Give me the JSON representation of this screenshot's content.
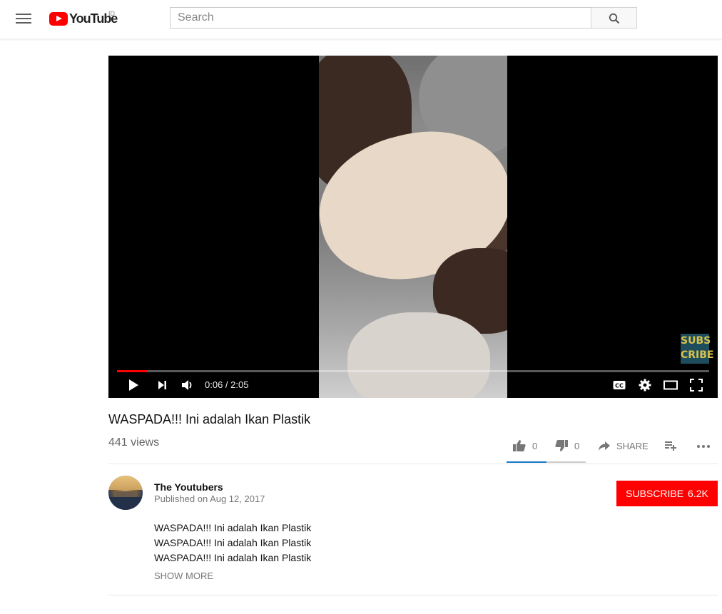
{
  "header": {
    "logo_text": "YouTube",
    "country_code": "ID",
    "search_placeholder": "Search",
    "icons": [
      "menu-icon",
      "youtube-logo",
      "search-icon"
    ]
  },
  "player": {
    "time_current": "0:06",
    "time_separator": " / ",
    "time_total": "2:05",
    "progress_fraction": 0.05,
    "watermark": {
      "line1": "SUBS",
      "line2": "CRIBE"
    },
    "icons": [
      "play-icon",
      "next-icon",
      "volume-icon",
      "captions-icon",
      "settings-icon",
      "theater-mode-icon",
      "fullscreen-icon"
    ],
    "colors": {
      "progress": "#ff0000",
      "background": "#000000"
    }
  },
  "video": {
    "title": "WASPADA!!! Ini adalah Ikan Plastik",
    "views": "441 views"
  },
  "actions": {
    "likes": "0",
    "dislikes": "0",
    "share_label": "SHARE",
    "like_fraction": 0.5,
    "icons": [
      "thumbs-up-icon",
      "thumbs-down-icon",
      "share-icon",
      "add-to-playlist-icon",
      "more-icon"
    ],
    "colors": {
      "like_bar": "#167ac6",
      "dislike_bar": "#cccccc"
    }
  },
  "owner": {
    "channel_name": "The Youtubers",
    "published": "Published on Aug 12, 2017",
    "subscribe_label": "SUBSCRIBE",
    "subscriber_count": "6.2K",
    "colors": {
      "subscribe": "#ff0000"
    }
  },
  "description": {
    "lines": [
      "WASPADA!!! Ini adalah Ikan Plastik",
      "WASPADA!!! Ini adalah Ikan Plastik",
      "WASPADA!!! Ini adalah Ikan Plastik"
    ],
    "show_more_label": "SHOW MORE"
  }
}
